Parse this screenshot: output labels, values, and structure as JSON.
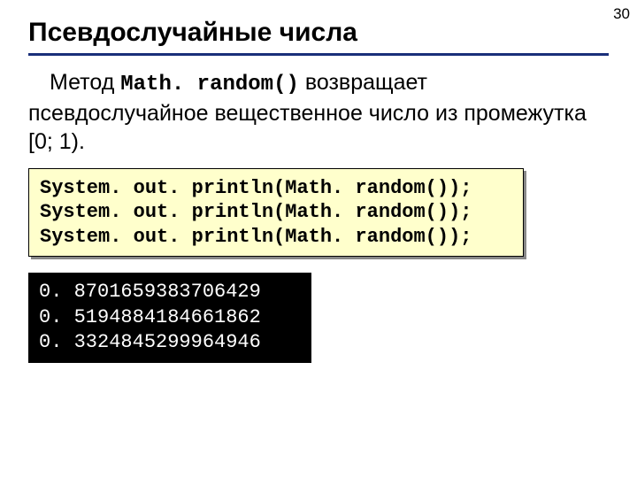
{
  "page_number": "30",
  "title": "Псевдослучайные числа",
  "body": {
    "part1": "Метод ",
    "method": "Math. random()",
    "part2": "  возвращает псевдослучайное вещественное число из промежутка [0; 1)."
  },
  "code": {
    "lines": [
      "System. out. println(Math. random());",
      "System. out. println(Math. random());",
      "System. out. println(Math. random());"
    ]
  },
  "output": {
    "lines": [
      "0. 8701659383706429",
      "0. 5194884184661862",
      "0. 3324845299964946"
    ]
  }
}
